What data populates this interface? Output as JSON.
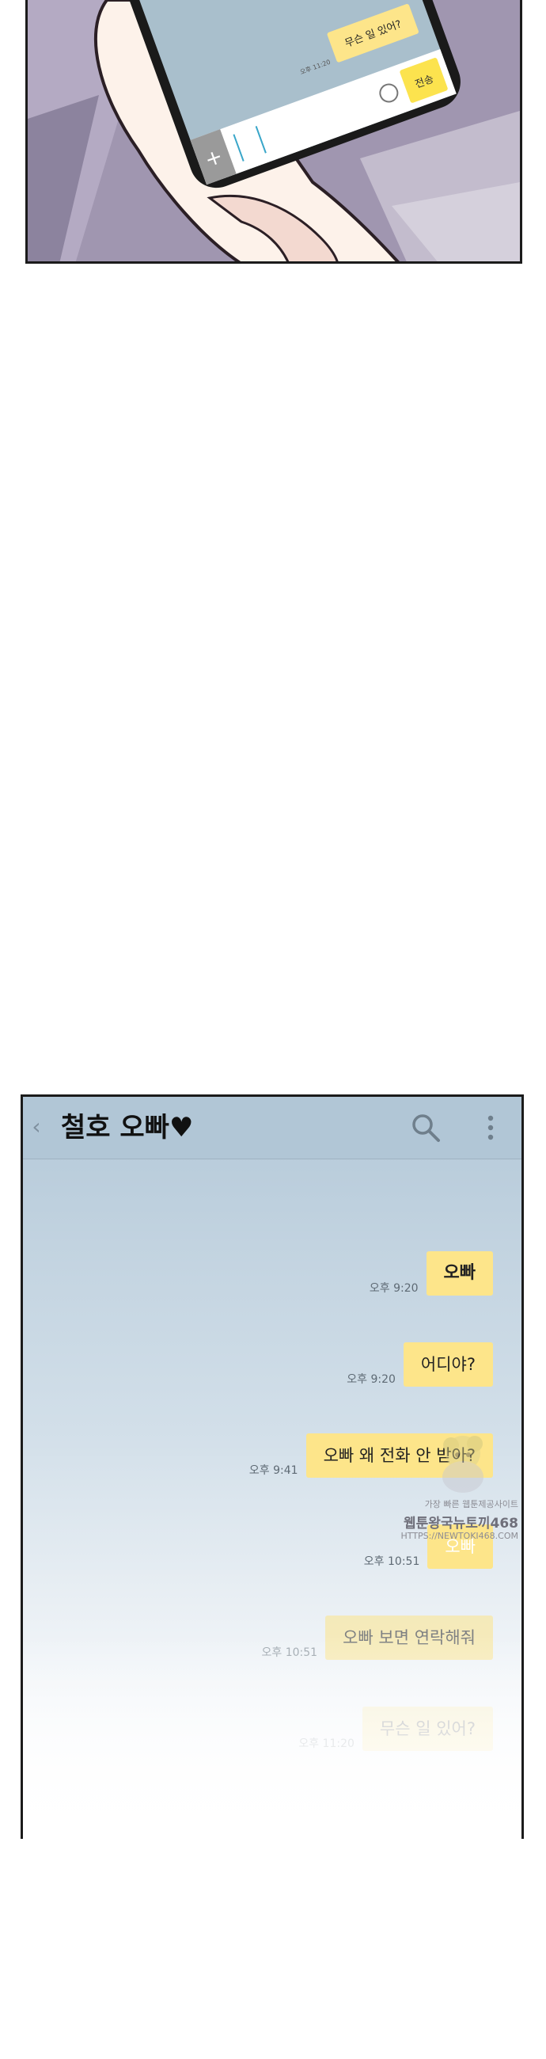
{
  "phone_panel": {
    "bubble_text": "무슨 일 있어?",
    "timestamp": "오후 11:20",
    "send_label": "전송",
    "plus_icon": "plus-icon",
    "emoji_icon": "smiley-icon"
  },
  "chat": {
    "back_icon": "chevron-left-icon",
    "title": "철호 오빠♥",
    "search_icon": "search-icon",
    "menu_icon": "vertical-dots-icon",
    "colors": {
      "header": "#b1c6d6",
      "bubble": "#fde58a",
      "text": "#111111"
    },
    "messages": [
      {
        "text": "오빠",
        "time": "오후 9:20"
      },
      {
        "text": "어디야?",
        "time": "오후 9:20"
      },
      {
        "text": "오빠 왜 전화 안 받아?",
        "time": "오후 9:41"
      },
      {
        "text": "오빠",
        "time": "오후 10:51"
      },
      {
        "text": "오빠 보면 연락해줘",
        "time": "오후 10:51"
      },
      {
        "text": "무슨 일 있어?",
        "time": "오후 11:20"
      }
    ]
  },
  "watermark": {
    "line1": "가장 빠른 웹툰제공사이트",
    "line2": "웹툰왕국뉴토끼468",
    "line3": "HTTPS://NEWTOKI468.COM"
  }
}
